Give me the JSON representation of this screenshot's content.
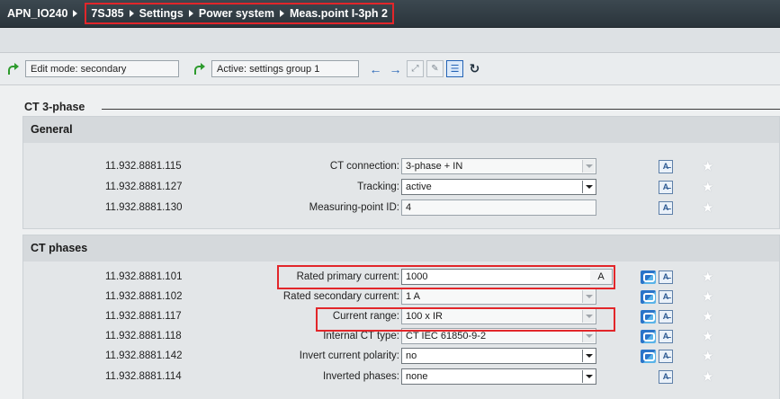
{
  "breadcrumb": {
    "root": "APN_IO240",
    "items": [
      "7SJ85",
      "Settings",
      "Power system",
      "Meas.point I-3ph 2"
    ]
  },
  "toolbar": {
    "edit_mode": "Edit mode: secondary",
    "active_group": "Active: settings group 1"
  },
  "section": {
    "title": "CT 3-phase"
  },
  "groups": [
    {
      "title": "General",
      "rows": [
        {
          "addr": "11.932.8881.115",
          "label": "CT connection:",
          "value": "3-phase + IN",
          "kind": "dropdown-disabled"
        },
        {
          "addr": "11.932.8881.127",
          "label": "Tracking:",
          "value": "active",
          "kind": "dropdown"
        },
        {
          "addr": "11.932.8881.130",
          "label": "Measuring-point ID:",
          "value": "4",
          "kind": "readonly"
        }
      ]
    },
    {
      "title": "CT phases",
      "rows": [
        {
          "addr": "11.932.8881.101",
          "label": "Rated primary current:",
          "value": "1000",
          "unit": "A",
          "kind": "input"
        },
        {
          "addr": "11.932.8881.102",
          "label": "Rated secondary current:",
          "value": "1 A",
          "kind": "dropdown-disabled"
        },
        {
          "addr": "11.932.8881.117",
          "label": "Current range:",
          "value": "100 x IR",
          "kind": "dropdown-disabled"
        },
        {
          "addr": "11.932.8881.118",
          "label": "Internal CT type:",
          "value": "CT IEC 61850-9-2",
          "kind": "dropdown-disabled"
        },
        {
          "addr": "11.932.8881.142",
          "label": "Invert current polarity:",
          "value": "no",
          "kind": "dropdown"
        },
        {
          "addr": "11.932.8881.114",
          "label": "Inverted phases:",
          "value": "none",
          "kind": "dropdown"
        }
      ]
    }
  ],
  "icons": {
    "param_icon_text": "A",
    "highlight_color": "#e2262a"
  }
}
